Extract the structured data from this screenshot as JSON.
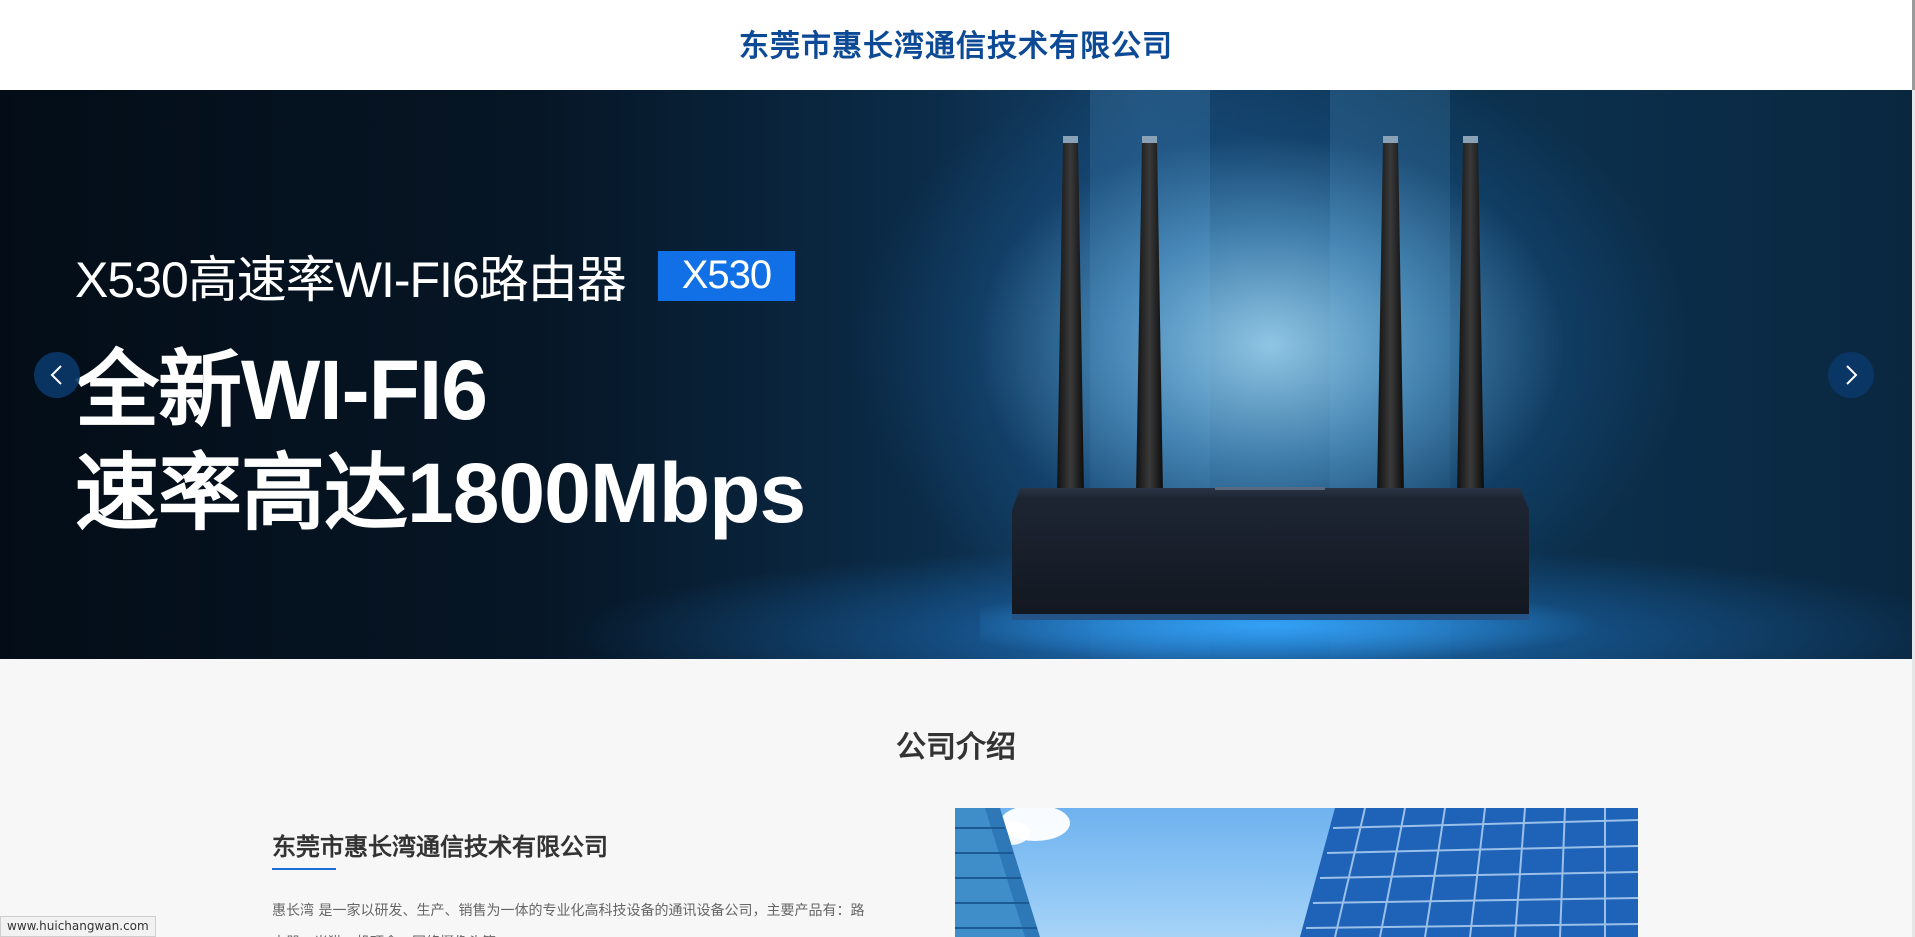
{
  "header": {
    "site_title": "东莞市惠长湾通信技术有限公司"
  },
  "banner": {
    "subtitle": "X530高速率WI-FI6路由器",
    "badge": "X530",
    "headline_1": "全新WI-FI6",
    "headline_2": "速率高达1800Mbps",
    "prev_icon": "chevron-left-icon",
    "next_icon": "chevron-right-icon"
  },
  "about": {
    "section_title": "公司介绍",
    "company_name": "东莞市惠长湾通信技术有限公司",
    "description": "惠长湾 是一家以研发、生产、销售为一体的专业化高科技设备的通讯设备公司，主要产品有：路由器、光猫、机顶盒、网络摄像头等"
  },
  "status_bar": {
    "url": "www.huichangwan.com"
  },
  "colors": {
    "brand_blue": "#0d4a96",
    "badge_blue": "#1170e6",
    "accent_underline": "#1a6fd6"
  }
}
